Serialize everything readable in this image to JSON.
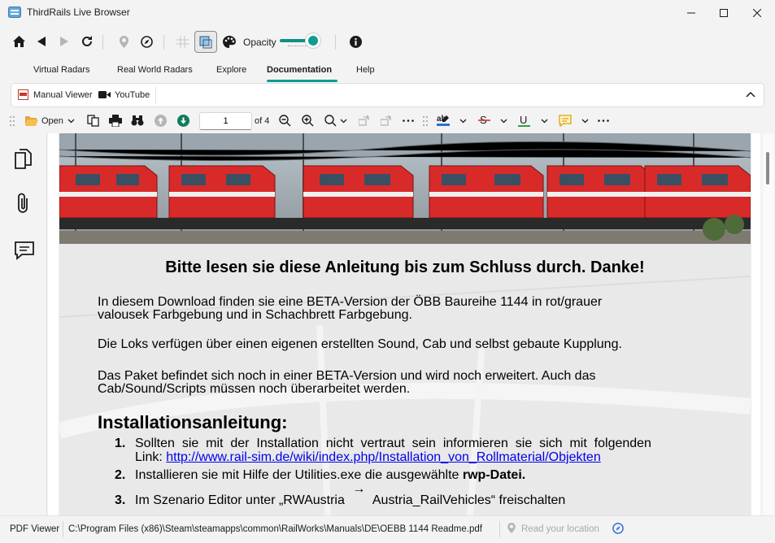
{
  "window": {
    "title": "ThirdRails Live Browser"
  },
  "nav": {
    "opacity_label": "Opacity",
    "opacity_value": 0.85
  },
  "tabs": [
    {
      "label": "Virtual Radars"
    },
    {
      "label": "Real World Radars"
    },
    {
      "label": "Explore"
    },
    {
      "label": "Documentation",
      "active": true
    },
    {
      "label": "Help"
    }
  ],
  "subtabs": [
    {
      "label": "Manual Viewer",
      "icon": "pdf-icon"
    },
    {
      "label": "YouTube",
      "icon": "video-camera-icon"
    }
  ],
  "pdf_toolbar": {
    "open_label": "Open",
    "page_value": "1",
    "page_total": "of 4"
  },
  "document": {
    "heading": "Bitte lesen sie diese Anleitung bis zum Schluss durch. Danke!",
    "para1_line1": "In diesem Download finden sie eine BETA-Version der ÖBB Baureihe 1144 in rot/grauer",
    "para1_line2": "valousek Farbgebung und in Schachbrett Farbgebung.",
    "para2": "Die Loks verfügen über einen eigenen erstellten Sound, Cab und selbst gebaute Kupplung.",
    "para3_line1": "Das Paket befindet sich noch in einer BETA-Version und wird noch erweitert. Auch das",
    "para3_line2": "Cab/Sound/Scripts müssen noch überarbeitet werden.",
    "section_title": "Installationsanleitung:",
    "steps": [
      {
        "num": "1.",
        "line1": "Sollten  sie  mit  der  Installation  nicht  vertraut  sein  informieren  sie  sich  mit  folgenden",
        "line2_prefix": "Link: ",
        "link": "http://www.rail-sim.de/wiki/index.php/Installation_von_Rollmaterial/Objekten"
      },
      {
        "num": "2.",
        "text_prefix": "Installieren sie mit Hilfe der Utilities.exe die ausgewählte ",
        "text_bold": "rwp-Datei."
      },
      {
        "num": "3.",
        "text": "Im Szenario Editor unter „RWAustria ",
        "text_rest": " Austria_RailVehicles“ freischalten"
      }
    ]
  },
  "status": {
    "viewer_label": "PDF Viewer",
    "file_path": "C:\\Program Files (x86)\\Steam\\steamapps\\common\\RailWorks\\Manuals\\DE\\OEBB 1144 Readme.pdf",
    "location_placeholder": "Read your location"
  },
  "colors": {
    "accent": "#0f9d8f",
    "loco_red": "#d92a2a",
    "link": "#0000ee"
  }
}
